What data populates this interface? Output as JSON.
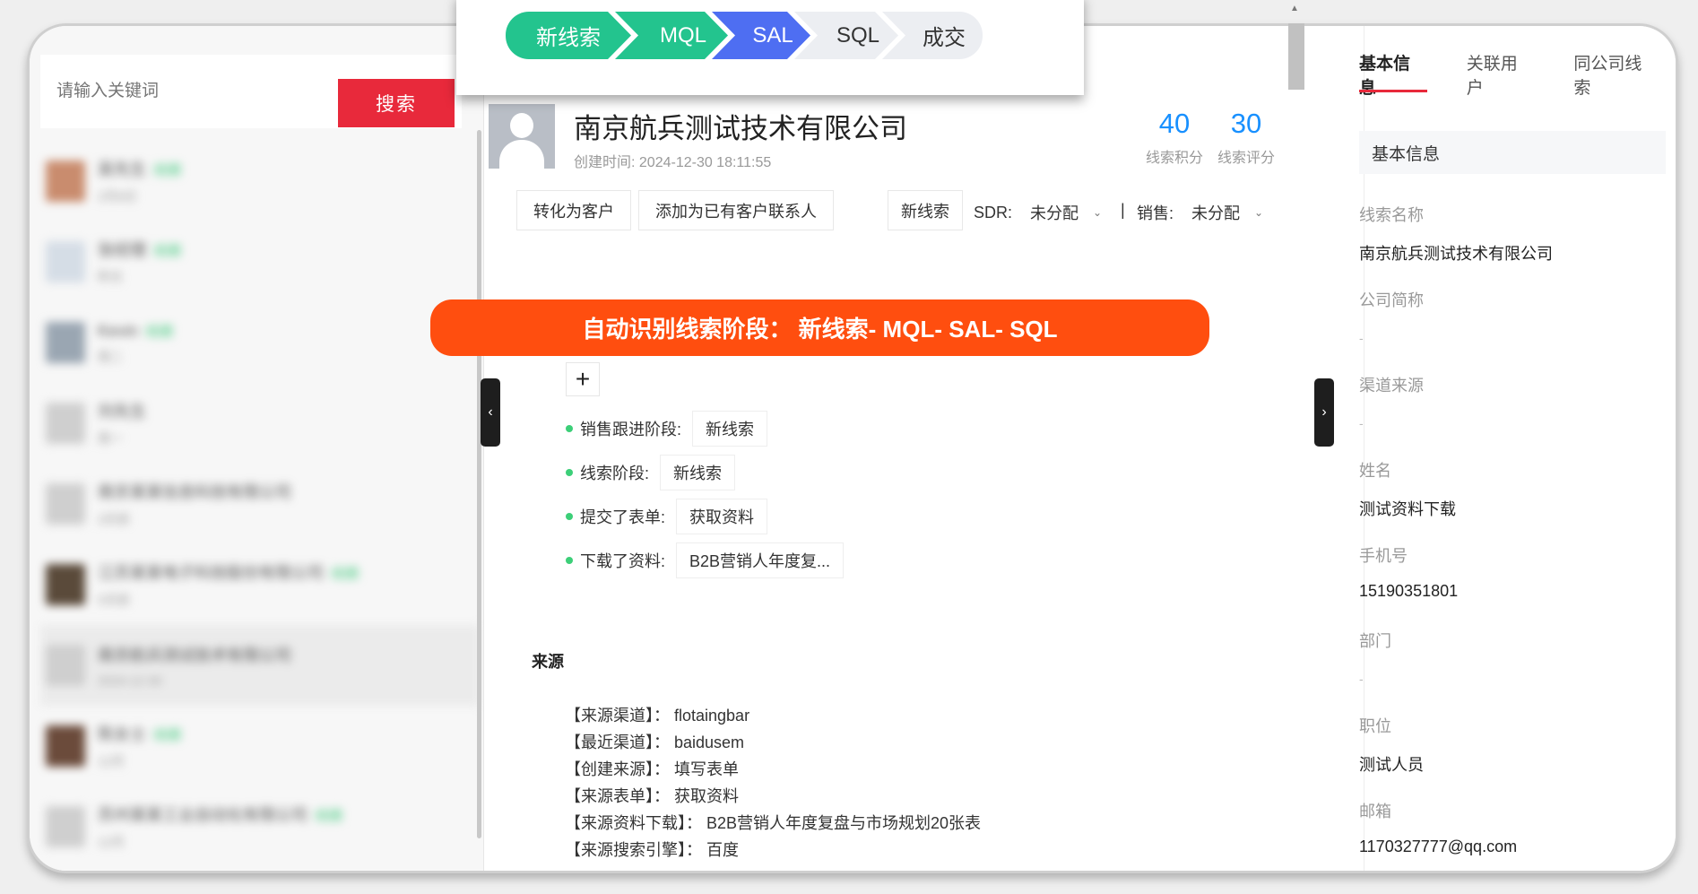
{
  "search": {
    "placeholder": "请输入关键词",
    "button": "搜索"
  },
  "pipeline": {
    "stages": [
      {
        "label": "新线索",
        "bg": "#23c48e",
        "fg": "#ffffff"
      },
      {
        "label": "MQL",
        "bg": "#23c48e",
        "fg": "#ffffff"
      },
      {
        "label": "SAL",
        "bg": "#4e6ef2",
        "fg": "#ffffff"
      },
      {
        "label": "SQL",
        "bg": "#eceef2",
        "fg": "#333333"
      },
      {
        "label": "成交",
        "bg": "#eceef2",
        "fg": "#333333"
      }
    ]
  },
  "lead": {
    "company": "南京航兵测试技术有限公司",
    "created": "创建时间: 2024-12-30 18:11:55",
    "score_points": {
      "value": "40",
      "label": "线索积分"
    },
    "score_rating": {
      "value": "30",
      "label": "线索评分"
    }
  },
  "actions": {
    "convert": "转化为客户",
    "add_contact": "添加为已有客户联系人",
    "stage": "新线索",
    "sdr_label": "SDR:",
    "sdr_value": "未分配",
    "sep": "|",
    "sales_label": "销售:",
    "sales_value": "未分配"
  },
  "banner": "自动识别线索阶段： 新线索- MQL- SAL- SQL",
  "plus": "+",
  "fields": [
    {
      "label": "销售跟进阶段:",
      "value": "新线索"
    },
    {
      "label": "线索阶段:",
      "value": "新线索"
    },
    {
      "label": "提交了表单:",
      "value": "获取资料"
    },
    {
      "label": "下载了资料:",
      "value": "B2B营销人年度复..."
    }
  ],
  "source": {
    "title": "来源",
    "lines": [
      "【来源渠道】： flotaingbar",
      "【最近渠道】： baidusem",
      "【创建来源】： 填写表单",
      "【来源表单】： 获取资料",
      "【来源资料下载】： B2B营销人年度复盘与市场规划20张表",
      "【来源搜索引擎】： 百度"
    ]
  },
  "right": {
    "tabs": [
      "基本信息",
      "关联用户",
      "同公司线索"
    ],
    "section": "基本信息",
    "items": [
      {
        "label": "线索名称",
        "value": "南京航兵测试技术有限公司"
      },
      {
        "label": "公司简称",
        "value": "-"
      },
      {
        "label": "渠道来源",
        "value": "-"
      },
      {
        "label": "姓名",
        "value": "测试资料下载"
      },
      {
        "label": "手机号",
        "value": "15190351801"
      },
      {
        "label": "部门",
        "value": "-"
      },
      {
        "label": "职位",
        "value": "测试人员"
      },
      {
        "label": "邮箱",
        "value": "1170327777@qq.com"
      }
    ]
  },
  "left_list": [
    {
      "name": "吴先生",
      "sub": "2月8日",
      "tag": "线索",
      "color": "#c98c6e"
    },
    {
      "name": "张经理",
      "sub": "昨天",
      "tag": "线索",
      "color": "#d5dde6"
    },
    {
      "name": "Kevin",
      "sub": "周二",
      "tag": "线索",
      "color": "#9aa6b2"
    },
    {
      "name": "刘先生",
      "sub": "周一",
      "tag": "",
      "color": "#cfcfcf"
    },
    {
      "name": "南京某某信息科技有限公司",
      "sub": "3天前",
      "tag": "",
      "color": "#cfcfcf"
    },
    {
      "name": "江苏某某电子科技股份有限公司",
      "sub": "5天前",
      "tag": "线索",
      "color": "#5a4a3a"
    },
    {
      "name": "南京航兵测试技术有限公司",
      "sub": "2024-12-30",
      "tag": "",
      "color": "#cfcfcf"
    },
    {
      "name": "陈女士",
      "sub": "12月",
      "tag": "线索",
      "color": "#6b4b3b"
    },
    {
      "name": "苏州某某工业自动化有限公司",
      "sub": "12月",
      "tag": "线索",
      "color": "#cfcfcf"
    }
  ]
}
